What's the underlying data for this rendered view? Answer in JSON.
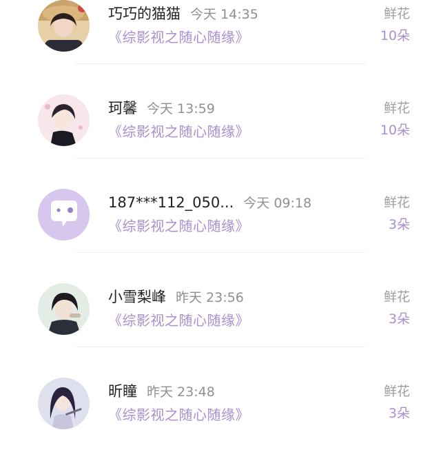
{
  "book_title": "《综影视之随心随缘》",
  "gift_type": "鲜花",
  "records": [
    {
      "name": "巧巧的猫猫",
      "time": "今天 14:35",
      "gift_count": "10朵",
      "avatar": "avatar-photo-girl-hat"
    },
    {
      "name": "珂馨",
      "time": "今天 13:59",
      "gift_count": "10朵",
      "avatar": "avatar-anime-boy"
    },
    {
      "name": "187***112_050...",
      "time": "今天 09:18",
      "gift_count": "3朵",
      "avatar": "avatar-default-chat"
    },
    {
      "name": "小雪梨峰",
      "time": "昨天 23:56",
      "gift_count": "3朵",
      "avatar": "avatar-anime-man"
    },
    {
      "name": "昕瞳",
      "time": "昨天 23:48",
      "gift_count": "3朵",
      "avatar": "avatar-anime-woman"
    }
  ],
  "colors": {
    "accent": "#a98fcf",
    "name": "#222222",
    "muted": "#8f8f8f",
    "default_avatar_bg": "#d7c7ee"
  }
}
